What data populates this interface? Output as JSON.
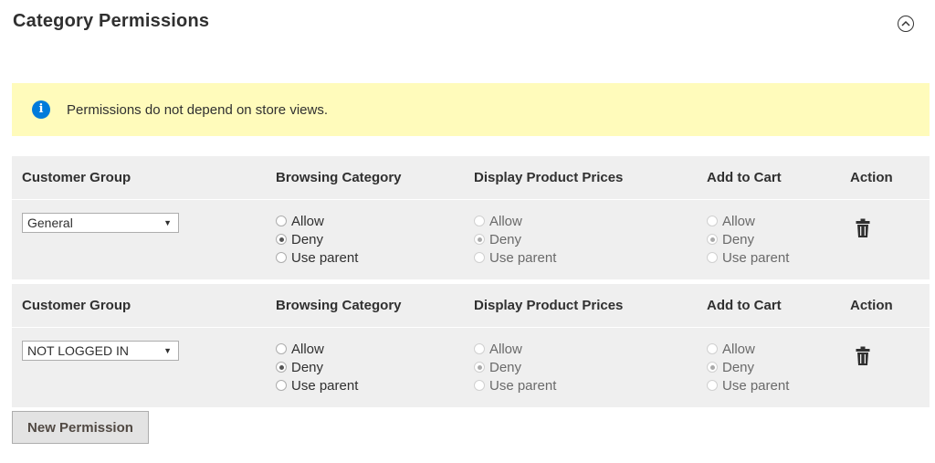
{
  "section": {
    "title": "Category Permissions",
    "collapse_icon": "chevron-up-circle-icon"
  },
  "notice": {
    "icon": "info-icon",
    "icon_glyph": "i",
    "text": "Permissions do not depend on store views.",
    "background": "#fffbbb",
    "icon_color": "#007bdb"
  },
  "columns": {
    "customer_group": "Customer Group",
    "browsing_category": "Browsing Category",
    "display_product_prices": "Display Product Prices",
    "add_to_cart": "Add to Cart",
    "action": "Action"
  },
  "radio_options": {
    "allow": "Allow",
    "deny": "Deny",
    "use_parent": "Use parent"
  },
  "permissions": [
    {
      "customer_group": "General",
      "browsing_category": "Deny",
      "display_product_prices": "Deny",
      "add_to_cart": "Deny",
      "action_icon": "trash-icon"
    },
    {
      "customer_group": "NOT LOGGED IN",
      "browsing_category": "Deny",
      "display_product_prices": "Deny",
      "add_to_cart": "Deny",
      "action_icon": "trash-icon"
    }
  ],
  "select_arrow": "▼",
  "new_permission_button": "New Permission"
}
